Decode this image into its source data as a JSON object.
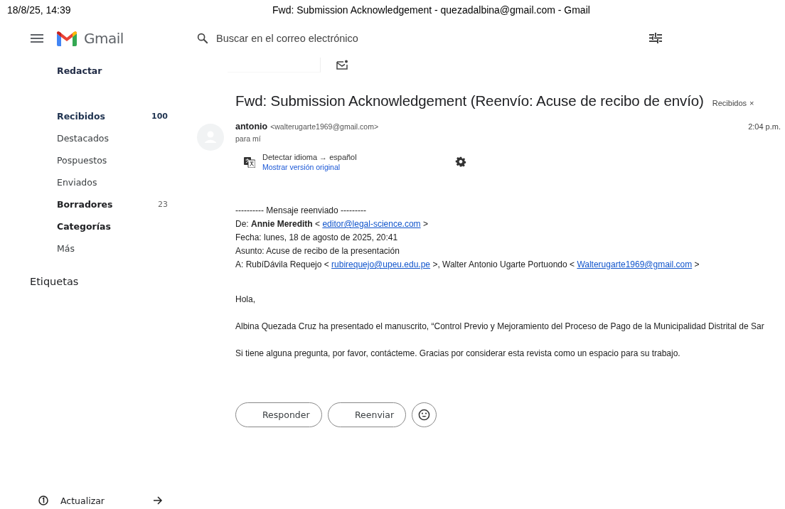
{
  "print_header": {
    "date": "18/8/25, 14:39",
    "title": "Fwd: Submission Acknowledgement - quezadalbina@gmail.com - Gmail"
  },
  "top_bar": {
    "app_name": "Gmail",
    "search": {
      "placeholder": "Buscar en el correo electrónico"
    }
  },
  "sidebar": {
    "compose": "Redactar",
    "items": [
      {
        "label": "Recibidos",
        "count": "100",
        "bold": true
      },
      {
        "label": "Destacados",
        "bold": false
      },
      {
        "label": "Pospuestos",
        "bold": false
      },
      {
        "label": "Enviados",
        "bold": false
      },
      {
        "label": "Borradores",
        "count": "23",
        "bold": true
      },
      {
        "label": "Categorías",
        "bold": true
      },
      {
        "label": "Más",
        "bold": false
      }
    ],
    "labels_heading": "Etiquetas",
    "footer": {
      "label": "Actualizar"
    }
  },
  "message": {
    "subject": "Fwd: Submission Acknowledgement (Reenvío: Acuse de recibo de envío)",
    "label_chip": {
      "label": "Recibidos",
      "remove": "×"
    },
    "sender": {
      "name": "antonio",
      "email": "<walterugarte1969@gmail.com>"
    },
    "time": "2:04 p.m.",
    "recipient": "para mí",
    "translation": {
      "text": "Detectar idioma → español",
      "link": "Mostrar versión original"
    },
    "body": [
      {
        "kind": "line",
        "parts": [
          {
            "kind": "text",
            "text": "---------- Mensaje reenviado ---------"
          }
        ]
      },
      {
        "kind": "line",
        "parts": [
          {
            "kind": "text",
            "text": "De: "
          },
          {
            "kind": "bold",
            "text": "Annie Meredith"
          },
          {
            "kind": "text",
            "text": " < "
          },
          {
            "kind": "link",
            "text": "editor@legal-science.com"
          },
          {
            "kind": "text",
            "text": " >"
          }
        ]
      },
      {
        "kind": "line",
        "parts": [
          {
            "kind": "text",
            "text": "Fecha: lunes, 18 de agosto de 2025, 20:41"
          }
        ]
      },
      {
        "kind": "line",
        "parts": [
          {
            "kind": "text",
            "text": "Asunto: Acuse de recibo de la presentación"
          }
        ]
      },
      {
        "kind": "line",
        "parts": [
          {
            "kind": "text",
            "text": "A: RubíDávila Requejo < "
          },
          {
            "kind": "link",
            "text": "rubirequejo@upeu.edu.pe"
          },
          {
            "kind": "text",
            "text": " >, Walter Antonio Ugarte Portuondo < "
          },
          {
            "kind": "link",
            "text": "Walterugarte1969@gmail.com"
          },
          {
            "kind": "text",
            "text": " >"
          }
        ]
      },
      {
        "kind": "gap"
      },
      {
        "kind": "paragraph",
        "parts": [
          {
            "kind": "text",
            "text": "Hola,"
          }
        ]
      },
      {
        "kind": "paragraph",
        "parts": [
          {
            "kind": "text",
            "text": "Albina Quezada Cruz ha presentado el manuscrito, “Control Previo y Mejoramiento del Proceso de Pago de la Municipalidad Distrital de Sar"
          }
        ]
      },
      {
        "kind": "paragraph",
        "parts": [
          {
            "kind": "text",
            "text": "Si tiene alguna pregunta, por favor, contácteme. Gracias por considerar esta revista como un espacio para su trabajo."
          }
        ]
      }
    ],
    "actions": [
      {
        "kind": "text",
        "label": "Responder"
      },
      {
        "kind": "text",
        "label": "Reenviar"
      },
      {
        "kind": "emoji"
      }
    ]
  }
}
